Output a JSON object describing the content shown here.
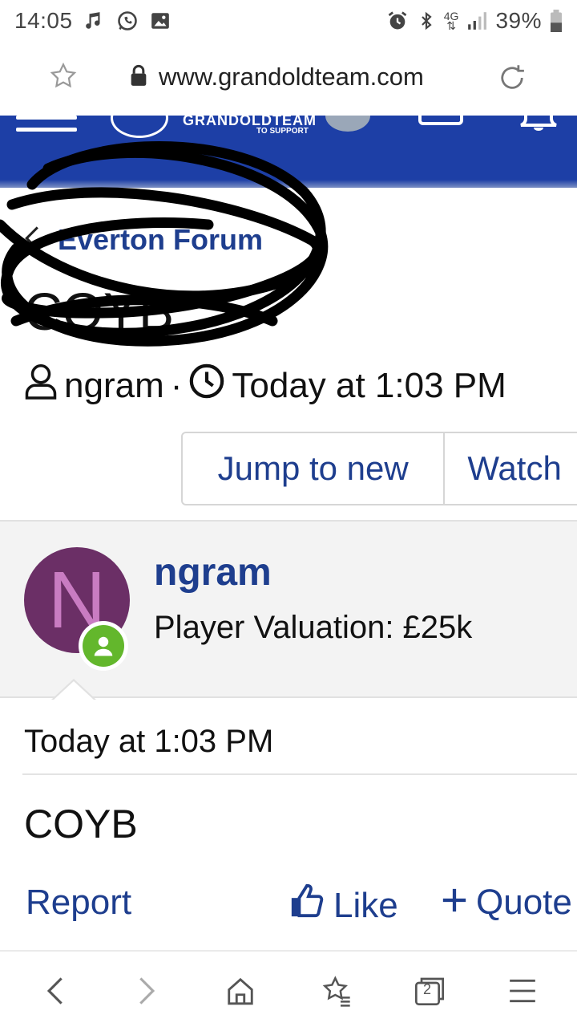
{
  "status_bar": {
    "time": "14:05",
    "battery": "39%",
    "network": "4G"
  },
  "browser": {
    "url": "www.grandoldteam.com"
  },
  "site_header": {
    "brand": "GRANDOLDTEAM",
    "tagline": "TO SUPPORT"
  },
  "thread": {
    "breadcrumb": "Everton Forum",
    "title": "COYB",
    "author": "ngram",
    "separator": "·",
    "posted": "Today at 1:03 PM"
  },
  "buttons": {
    "jump_to_new": "Jump to new",
    "watch": "Watch"
  },
  "post": {
    "avatar_letter": "N",
    "username": "ngram",
    "user_title": "Player Valuation: £25k",
    "date": "Today at 1:03 PM",
    "body": "COYB",
    "report": "Report",
    "like": "Like",
    "quote": "Quote"
  },
  "bottom_nav": {
    "tabs_count": "2"
  },
  "colors": {
    "header_blue": "#1d3fa6",
    "link_blue": "#1e3e8e",
    "avatar_bg": "#6b2f66",
    "online_green": "#63b72c"
  },
  "icons": [
    "music-icon",
    "whatsapp-icon",
    "image-icon",
    "alarm-icon",
    "bluetooth-icon",
    "signal-icon",
    "battery-icon",
    "star-icon",
    "lock-icon",
    "reload-icon",
    "menu-icon",
    "inbox-icon",
    "bell-icon",
    "chevron-left-icon",
    "user-icon",
    "clock-icon",
    "thumbs-up-icon",
    "plus-icon",
    "back-icon",
    "forward-icon",
    "home-icon",
    "bookmarks-icon",
    "tabs-icon",
    "hamburger-icon"
  ]
}
